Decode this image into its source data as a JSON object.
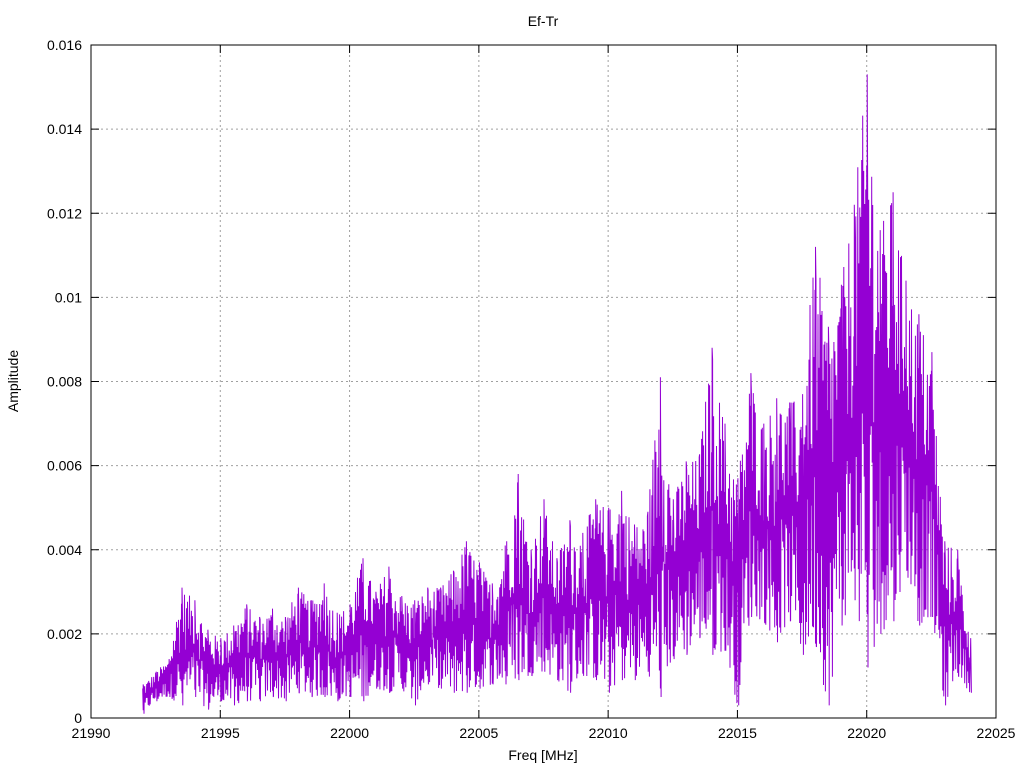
{
  "chart_data": {
    "type": "line",
    "title": "Ef-Tr",
    "xlabel": "Freq [MHz]",
    "ylabel": "Amplitude",
    "xlim": [
      21990,
      22025
    ],
    "ylim": [
      0,
      0.016
    ],
    "x_ticks": [
      21990,
      21995,
      22000,
      22005,
      22010,
      22015,
      22020,
      22025
    ],
    "y_ticks": [
      0,
      0.002,
      0.004,
      0.006,
      0.008,
      0.01,
      0.012,
      0.014,
      0.016
    ],
    "x_tick_labels": [
      "21990",
      "21995",
      "22000",
      "22005",
      "22010",
      "22015",
      "22020",
      "22025"
    ],
    "y_tick_labels": [
      "0",
      "0.002",
      "0.004",
      "0.006",
      "0.008",
      "0.01",
      "0.012",
      "0.014",
      "0.016"
    ],
    "grid": true,
    "series_color": "#9400d3",
    "series": [
      {
        "x": [
          21992.0,
          21992.5,
          21993.0,
          21993.5,
          21994.0,
          21994.5,
          21995.0,
          21995.5,
          21996.0,
          21996.5,
          21997.0,
          21997.5,
          21998.0,
          21998.5,
          21999.0,
          21999.5,
          22000.0,
          22000.5,
          22001.0,
          22001.5,
          22002.0,
          22002.5,
          22003.0,
          22003.5,
          22004.0,
          22004.5,
          22005.0,
          22005.5,
          22006.0,
          22006.5,
          22007.0,
          22007.5,
          22008.0,
          22008.5,
          22009.0,
          22009.5,
          22010.0,
          22010.5,
          22011.0,
          22011.5,
          22012.0,
          22012.5,
          22013.0,
          22013.5,
          22014.0,
          22014.5,
          22015.0,
          22015.5,
          22016.0,
          22016.5,
          22017.0,
          22017.5,
          22018.0,
          22018.5,
          22019.0,
          22019.5,
          22020.0,
          22020.5,
          22021.0,
          22021.5,
          22022.0,
          22022.5,
          22023.0,
          22023.5,
          22024.0
        ],
        "min": [
          0.0001,
          0.0004,
          0.0005,
          0.0003,
          0.0005,
          0.0002,
          0.0004,
          0.0003,
          0.0004,
          0.0004,
          0.0005,
          0.0004,
          0.0006,
          0.0005,
          0.0005,
          0.0004,
          0.0005,
          0.0004,
          0.0007,
          0.0006,
          0.0007,
          0.0003,
          0.0008,
          0.0007,
          0.0006,
          0.0006,
          0.0007,
          0.0008,
          0.0008,
          0.0009,
          0.001,
          0.0011,
          0.0009,
          0.0006,
          0.001,
          0.0009,
          0.0006,
          0.0009,
          0.0009,
          0.0011,
          0.0005,
          0.0014,
          0.0015,
          0.0019,
          0.0015,
          0.0016,
          0.0003,
          0.0024,
          0.0023,
          0.0018,
          0.0023,
          0.0015,
          0.0017,
          0.0003,
          0.0022,
          0.0028,
          0.0012,
          0.002,
          0.0023,
          0.0035,
          0.0022,
          0.0024,
          0.0003,
          0.001,
          0.0006
        ],
        "max": [
          0.0008,
          0.0011,
          0.0014,
          0.0031,
          0.0028,
          0.0021,
          0.0019,
          0.0022,
          0.0027,
          0.0024,
          0.0026,
          0.0024,
          0.0031,
          0.0028,
          0.0032,
          0.0025,
          0.0027,
          0.0038,
          0.003,
          0.0036,
          0.0029,
          0.0028,
          0.0031,
          0.0031,
          0.0035,
          0.0042,
          0.0037,
          0.0032,
          0.0041,
          0.0058,
          0.004,
          0.0052,
          0.0038,
          0.0047,
          0.0044,
          0.0052,
          0.005,
          0.0054,
          0.0046,
          0.0048,
          0.0081,
          0.0052,
          0.0061,
          0.0062,
          0.0088,
          0.007,
          0.0057,
          0.0082,
          0.007,
          0.0076,
          0.0075,
          0.0077,
          0.0112,
          0.0093,
          0.0103,
          0.0122,
          0.0153,
          0.0116,
          0.0125,
          0.0104,
          0.0096,
          0.0087,
          0.0042,
          0.004,
          0.0019
        ]
      }
    ]
  }
}
